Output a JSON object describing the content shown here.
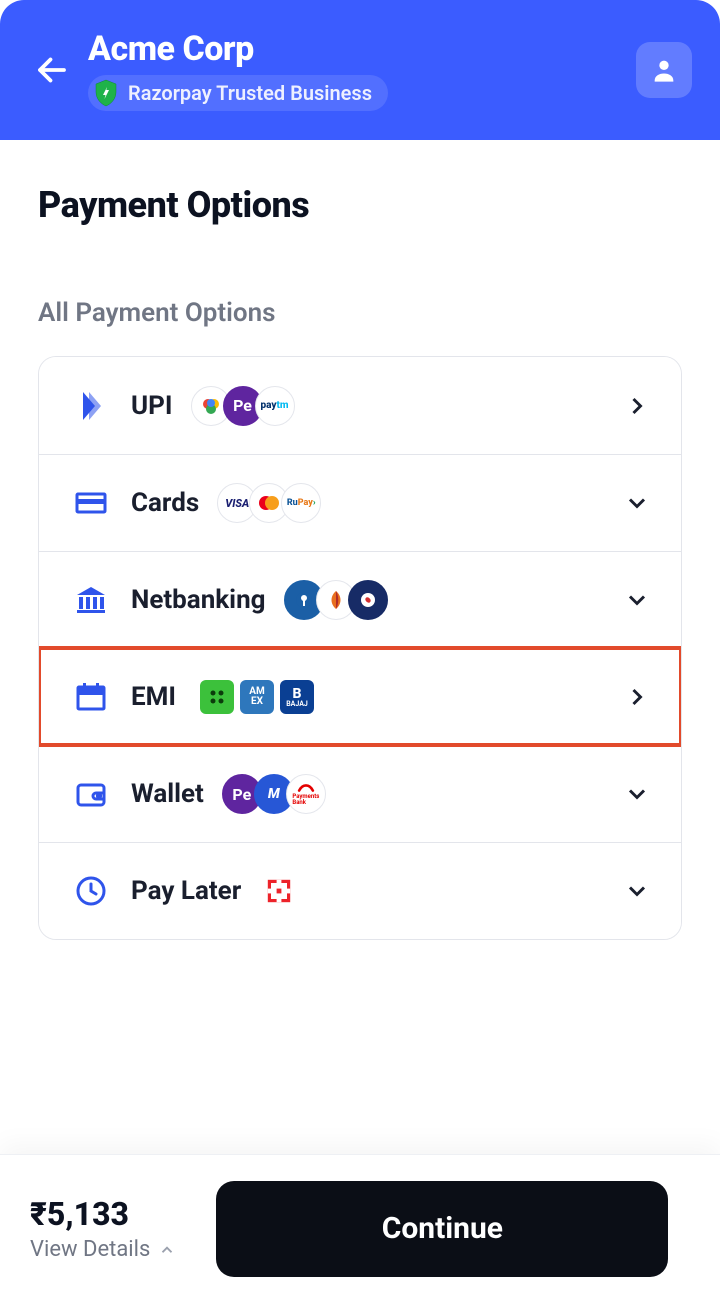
{
  "header": {
    "merchant": "Acme Corp",
    "trusted_label": "Razorpay Trusted Business"
  },
  "page": {
    "title": "Payment Options",
    "section": "All Payment Options"
  },
  "options": [
    {
      "id": "upi",
      "label": "UPI",
      "chevron": "right",
      "highlight": false
    },
    {
      "id": "cards",
      "label": "Cards",
      "chevron": "down",
      "highlight": false
    },
    {
      "id": "netbanking",
      "label": "Netbanking",
      "chevron": "down",
      "highlight": false
    },
    {
      "id": "emi",
      "label": "EMI",
      "chevron": "right",
      "highlight": true
    },
    {
      "id": "wallet",
      "label": "Wallet",
      "chevron": "down",
      "highlight": false
    },
    {
      "id": "paylater",
      "label": "Pay Later",
      "chevron": "down",
      "highlight": false
    }
  ],
  "footer": {
    "amount": "₹5,133",
    "view_details": "View Details",
    "continue": "Continue"
  },
  "colors": {
    "primary": "#3b5cff",
    "highlight_border": "#e24a2b"
  }
}
